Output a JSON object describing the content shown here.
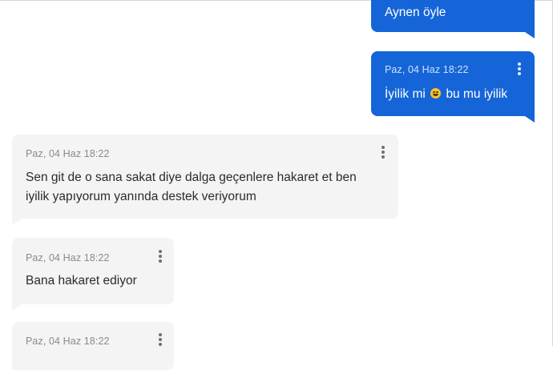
{
  "messages": [
    {
      "id": "m0",
      "direction": "out",
      "timestamp": "",
      "text": "Aynen öyle"
    },
    {
      "id": "m1",
      "direction": "out",
      "timestamp": "Paz, 04 Haz 18:22",
      "text_before_emoji": "İyilik mi",
      "emoji": "grinning-face-icon",
      "text_after_emoji": "bu mu iyilik"
    },
    {
      "id": "m2",
      "direction": "in",
      "timestamp": "Paz, 04 Haz 18:22",
      "text_line1": "Sen git de o sana sakat diye dalga geçenlere hakaret et ben",
      "text_line2": "iyilik yapıyorum yanında destek veriyorum"
    },
    {
      "id": "m3",
      "direction": "in",
      "timestamp": "Paz, 04 Haz 18:22",
      "text": "Bana hakaret ediyor"
    },
    {
      "id": "m4",
      "direction": "in",
      "timestamp": "Paz, 04 Haz 18:22",
      "text": ""
    }
  ],
  "colors": {
    "outgoing_bubble": "#1565d8",
    "incoming_bubble": "#f4f4f4",
    "incoming_text": "#2b2b2b",
    "timestamp_incoming": "#8a8a8a"
  },
  "icons": {
    "message_menu": "kebab-menu-icon"
  }
}
